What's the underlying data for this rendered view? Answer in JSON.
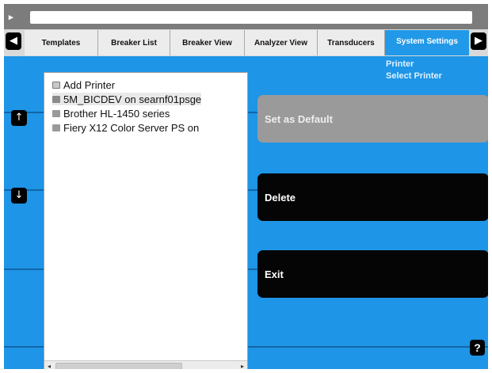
{
  "tabs": [
    {
      "label": "Templates"
    },
    {
      "label": "Breaker List"
    },
    {
      "label": "Breaker View"
    },
    {
      "label": "Analyzer View"
    },
    {
      "label": "Transducers"
    },
    {
      "label": "System Settings",
      "active": true
    }
  ],
  "breadcrumb": [
    "Printer",
    "Select Printer"
  ],
  "printers": [
    {
      "label": "Add Printer",
      "icon": "add-printer-icon"
    },
    {
      "label": "5M_BICDEV on searnf01psge",
      "icon": "network-printer-icon",
      "selected": true
    },
    {
      "label": "Brother HL-1450 series",
      "icon": "printer-icon"
    },
    {
      "label": "Fiery X12 Color Server PS on",
      "icon": "printer-icon"
    }
  ],
  "buttons": {
    "set_default": "Set as Default",
    "delete": "Delete",
    "exit": "Exit",
    "help": "?"
  },
  "icons": {
    "nav_left": "◀",
    "nav_right": "▶",
    "scroll_up": "↑",
    "scroll_down": "↓"
  },
  "colors": {
    "accent": "#1e95e6",
    "active_tab": "#2299e8",
    "disabled_button": "#9a9a9a",
    "button": "#050505"
  }
}
